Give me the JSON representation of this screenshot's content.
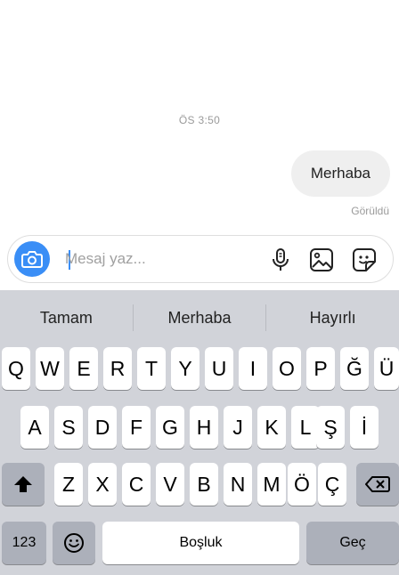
{
  "chat": {
    "timestamp": "ÖS 3:50",
    "message": "Merhaba",
    "seen_label": "Görüldü"
  },
  "composer": {
    "placeholder": "Mesaj yaz...",
    "accent_color": "#3a8ef6",
    "icons": [
      "camera-icon",
      "microphone-icon",
      "gallery-icon",
      "sticker-icon"
    ]
  },
  "keyboard": {
    "suggestions": [
      "Tamam",
      "Merhaba",
      "Hayırlı"
    ],
    "row1": [
      "Q",
      "W",
      "E",
      "R",
      "T",
      "Y",
      "U",
      "I",
      "O",
      "P",
      "Ğ",
      "Ü"
    ],
    "row2": [
      "A",
      "S",
      "D",
      "F",
      "G",
      "H",
      "J",
      "K",
      "L",
      "Ş",
      "İ"
    ],
    "row3": [
      "Z",
      "X",
      "C",
      "V",
      "B",
      "N",
      "M",
      "Ö",
      "Ç"
    ],
    "numbers_label": "123",
    "space_label": "Boşluk",
    "return_label": "Geç",
    "icons": [
      "shift-icon",
      "backspace-icon",
      "emoji-icon"
    ]
  }
}
